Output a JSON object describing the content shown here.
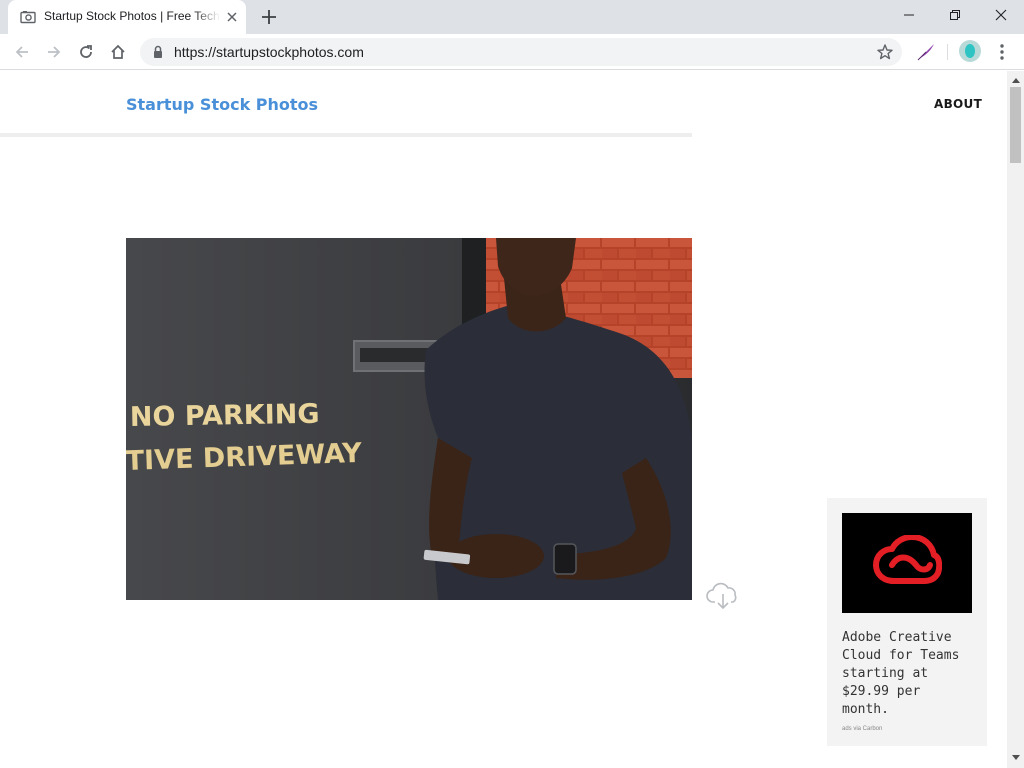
{
  "browser": {
    "tab": {
      "title": "Startup Stock Photos | Free Tech Stock Photos",
      "favicon": "camera-icon"
    },
    "url": "https://startupstockphotos.com",
    "controls": [
      "back-icon",
      "forward-icon",
      "reload-icon",
      "home-icon"
    ],
    "window_controls": [
      "minimize-icon",
      "restore-icon",
      "close-icon"
    ]
  },
  "site": {
    "title": "Startup Stock Photos",
    "nav": {
      "about": "ABOUT"
    },
    "brand_color": "#4a90d9"
  },
  "photo": {
    "sign_line1": "NO PARKING",
    "sign_line2": "TIVE DRIVEWAY",
    "download_icon": "cloud-download-icon"
  },
  "ad": {
    "text": "Adobe Creative Cloud for Teams starting at $29.99 per month.",
    "via": "ads via Carbon",
    "logo_color": "#e31e24"
  }
}
